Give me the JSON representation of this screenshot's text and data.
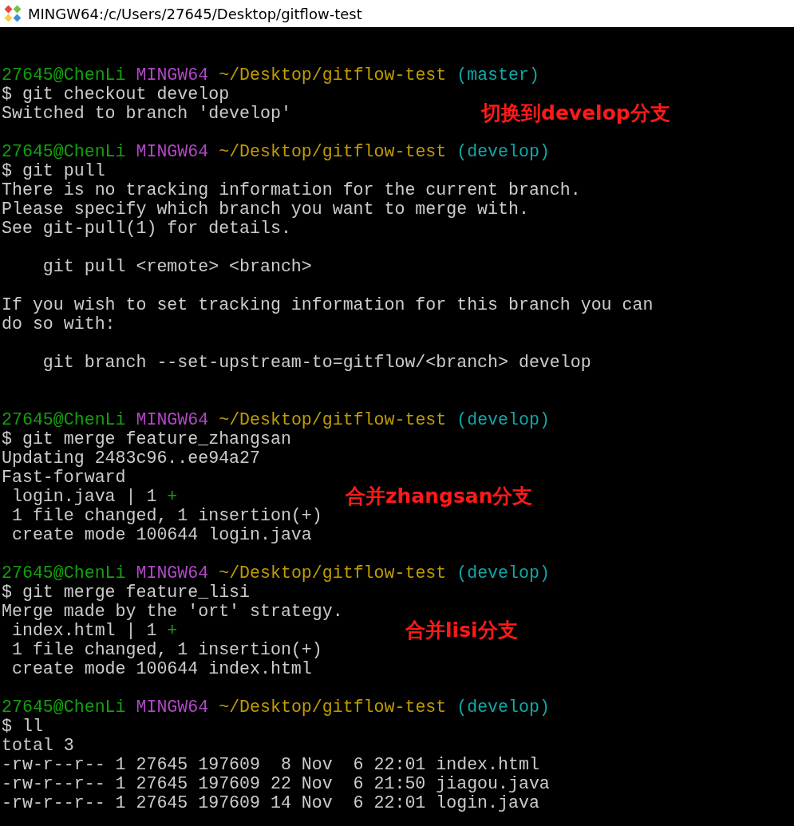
{
  "window": {
    "title": "MINGW64:/c/Users/27645/Desktop/gitflow-test"
  },
  "lines": [
    {
      "kind": "blank"
    },
    {
      "kind": "blank"
    },
    {
      "kind": "prompt",
      "user": "27645@ChenLi",
      "system": "MINGW64",
      "path": "~/Desktop/gitflow-test",
      "branch": "(master)"
    },
    {
      "kind": "output",
      "text": "$ git checkout develop"
    },
    {
      "kind": "output",
      "text": "Switched to branch 'develop'",
      "note": "切换到develop分支"
    },
    {
      "kind": "blank"
    },
    {
      "kind": "prompt",
      "user": "27645@ChenLi",
      "system": "MINGW64",
      "path": "~/Desktop/gitflow-test",
      "branch": "(develop)"
    },
    {
      "kind": "output",
      "text": "$ git pull"
    },
    {
      "kind": "output",
      "text": "There is no tracking information for the current branch."
    },
    {
      "kind": "output",
      "text": "Please specify which branch you want to merge with."
    },
    {
      "kind": "output",
      "text": "See git-pull(1) for details."
    },
    {
      "kind": "blank"
    },
    {
      "kind": "output",
      "text": "    git pull <remote> <branch>"
    },
    {
      "kind": "blank"
    },
    {
      "kind": "output",
      "text": "If you wish to set tracking information for this branch you can"
    },
    {
      "kind": "output",
      "text": "do so with:"
    },
    {
      "kind": "blank"
    },
    {
      "kind": "output",
      "text": "    git branch --set-upstream-to=gitflow/<branch> develop"
    },
    {
      "kind": "blank"
    },
    {
      "kind": "blank"
    },
    {
      "kind": "prompt",
      "user": "27645@ChenLi",
      "system": "MINGW64",
      "path": "~/Desktop/gitflow-test",
      "branch": "(develop)"
    },
    {
      "kind": "output",
      "text": "$ git merge feature_zhangsan"
    },
    {
      "kind": "output",
      "text": "Updating 2483c96..ee94a27"
    },
    {
      "kind": "output",
      "text": "Fast-forward"
    },
    {
      "kind": "diffstat",
      "text": " login.java | 1",
      "plus": "+",
      "note": "合并zhangsan分支"
    },
    {
      "kind": "output",
      "text": " 1 file changed, 1 insertion(+)"
    },
    {
      "kind": "output",
      "text": " create mode 100644 login.java"
    },
    {
      "kind": "blank"
    },
    {
      "kind": "prompt",
      "user": "27645@ChenLi",
      "system": "MINGW64",
      "path": "~/Desktop/gitflow-test",
      "branch": "(develop)"
    },
    {
      "kind": "output",
      "text": "$ git merge feature_lisi"
    },
    {
      "kind": "output",
      "text": "Merge made by the 'ort' strategy."
    },
    {
      "kind": "diffstat",
      "text": " index.html | 1",
      "plus": "+",
      "note": "合并lisi分支"
    },
    {
      "kind": "output",
      "text": " 1 file changed, 1 insertion(+)"
    },
    {
      "kind": "output",
      "text": " create mode 100644 index.html"
    },
    {
      "kind": "blank"
    },
    {
      "kind": "prompt",
      "user": "27645@ChenLi",
      "system": "MINGW64",
      "path": "~/Desktop/gitflow-test",
      "branch": "(develop)"
    },
    {
      "kind": "output",
      "text": "$ ll"
    },
    {
      "kind": "output",
      "text": "total 3"
    },
    {
      "kind": "output",
      "text": "-rw-r--r-- 1 27645 197609  8 Nov  6 22:01 index.html"
    },
    {
      "kind": "output",
      "text": "-rw-r--r-- 1 27645 197609 22 Nov  6 21:50 jiagou.java"
    },
    {
      "kind": "output",
      "text": "-rw-r--r-- 1 27645 197609 14 Nov  6 22:01 login.java"
    }
  ]
}
